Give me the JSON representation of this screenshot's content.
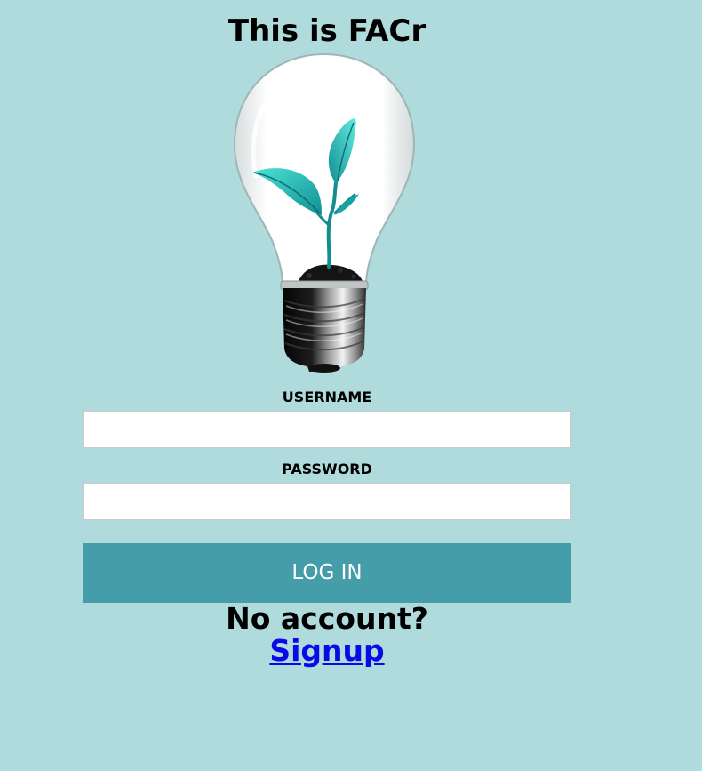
{
  "page": {
    "title": "This is FACr"
  },
  "logo": {
    "icon": "lightbulb-with-sprout-icon"
  },
  "form": {
    "username_label": "USERNAME",
    "username_value": "",
    "password_label": "PASSWORD",
    "password_value": "",
    "login_label": "LOG IN"
  },
  "footer": {
    "no_account_text": "No account?",
    "signup_link": "Signup"
  },
  "colors": {
    "background": "#afdbdc",
    "button": "#449da9",
    "button_text": "#ffffff",
    "link": "#0a0ae8"
  }
}
